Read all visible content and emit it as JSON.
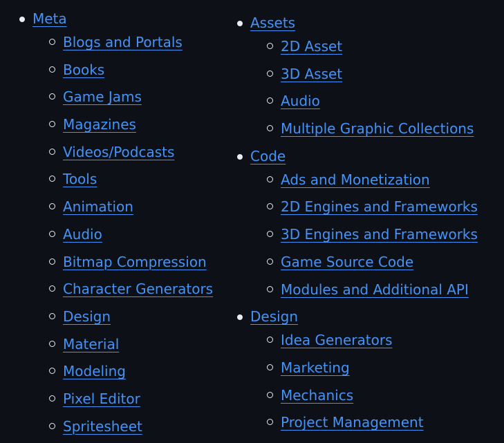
{
  "left_column": [
    {
      "label": "Meta",
      "children": [
        "Blogs and Portals",
        "Books",
        "Game Jams",
        "Magazines",
        "Videos/Podcasts",
        "Tools",
        "Animation",
        "Audio",
        "Bitmap Compression",
        "Character Generators",
        "Design",
        "Material",
        "Modeling",
        "Pixel Editor",
        "Spritesheet"
      ]
    }
  ],
  "right_column": [
    {
      "label": "Assets",
      "children": [
        "2D Asset",
        "3D Asset",
        "Audio",
        "Multiple Graphic Collections"
      ]
    },
    {
      "label": "Code",
      "children": [
        "Ads and Monetization",
        "2D Engines and Frameworks",
        "3D Engines and Frameworks",
        "Game Source Code",
        "Modules and Additional API"
      ]
    },
    {
      "label": "Design",
      "children": [
        "Idea Generators",
        "Marketing",
        "Mechanics",
        "Project Management"
      ]
    }
  ],
  "colors": {
    "background": "#0d1117",
    "link": "#4493f8",
    "bullet": "#e6edf3"
  },
  "icons": {
    "top_bullet": "filled-disc-icon",
    "sub_bullet": "hollow-circle-icon"
  }
}
